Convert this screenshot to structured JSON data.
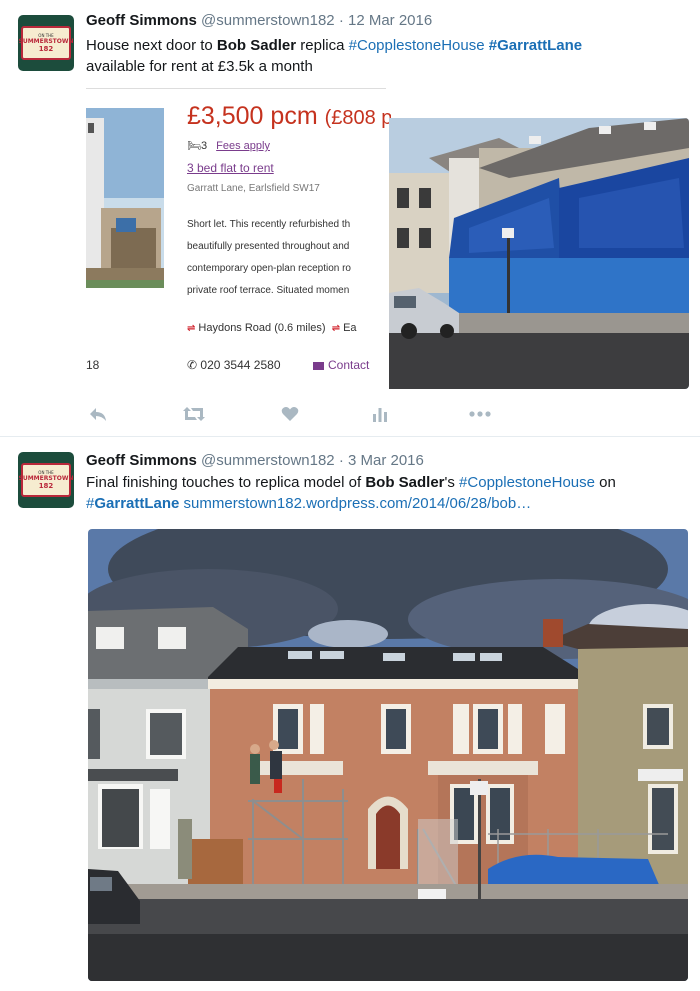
{
  "tweets": [
    {
      "author": "Geoff Simmons",
      "handle": "@summerstown182",
      "separator": "·",
      "date": "12 Mar 2016",
      "text_parts": [
        "House next door to ",
        "Bob Sadler",
        " replica ",
        "#Copplestone",
        "House",
        " ",
        "#Garratt",
        "Lane",
        "available for rent at £3.5k a month"
      ],
      "listing": {
        "price": "£3,500 pcm",
        "price_extra": "(£808 p",
        "beds": "3",
        "fees": "Fees apply",
        "title": "3 bed flat to rent",
        "address": "Garratt Lane, Earlsfield SW17",
        "description_lines": [
          "Short let. This recently refurbished th",
          "beautifully presented throughout and",
          "contemporary open-plan reception ro",
          "private roof terrace. Situated momen"
        ],
        "station_1": "Haydons Road (0.6 miles)",
        "station_2": "Ea",
        "page_fragment": "18",
        "phone": "020 3544 2580",
        "contact": "Contact"
      }
    },
    {
      "author": "Geoff Simmons",
      "handle": "@summerstown182",
      "separator": "·",
      "date": "3 Mar 2016",
      "text_parts": [
        "Final finishing touches to replica model of ",
        "Bob Sadler",
        "'s ",
        "#CopplestoneHouse",
        " on",
        "#",
        "GarrattLane",
        " ",
        "summerstown182.wordpress.com/2014/06/28/bob…"
      ]
    }
  ],
  "avatar": {
    "top": "SUMMERSTOWN",
    "mid": "182",
    "small": "ON THE"
  },
  "colors": {
    "link": "#1b6fb5",
    "price": "#c5321e",
    "listing_link": "#7a3c8c",
    "action_icon": "#aab8c2"
  },
  "action_icons": [
    "reply-icon",
    "retweet-icon",
    "like-icon",
    "analytics-icon",
    "more-icon"
  ]
}
